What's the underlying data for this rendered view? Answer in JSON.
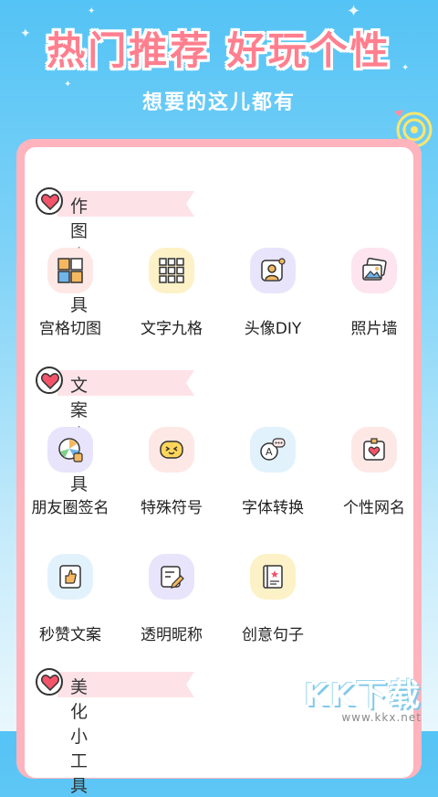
{
  "banner": {
    "title": "热门推荐 好玩个性",
    "subtitle": "想要的这儿都有"
  },
  "sections": [
    {
      "label": "作图小工具",
      "tools": [
        {
          "label": "宫格切图",
          "icon": "grid-split-icon",
          "bg": "#fde8e6"
        },
        {
          "label": "文字九格",
          "icon": "nine-grid-text-icon",
          "bg": "#fdf1c7"
        },
        {
          "label": "头像DIY",
          "icon": "avatar-diy-icon",
          "bg": "#e8e4fb"
        },
        {
          "label": "照片墙",
          "icon": "photo-wall-icon",
          "bg": "#fde4ee"
        }
      ]
    },
    {
      "label": "文案小工具",
      "tools": [
        {
          "label": "朋友圈签名",
          "icon": "moments-signature-icon",
          "bg": "#e8e4fb"
        },
        {
          "label": "特殊符号",
          "icon": "emoji-symbol-icon",
          "bg": "#fde8e6"
        },
        {
          "label": "字体转换",
          "icon": "font-convert-icon",
          "bg": "#e2f2fc"
        },
        {
          "label": "个性网名",
          "icon": "nickname-card-icon",
          "bg": "#fde8e6"
        },
        {
          "label": "秒赞文案",
          "icon": "thumbs-up-icon",
          "bg": "#e2f2fc"
        },
        {
          "label": "透明昵称",
          "icon": "transparent-name-icon",
          "bg": "#e8e4fb"
        },
        {
          "label": "创意句子",
          "icon": "creative-book-icon",
          "bg": "#fdf1c7"
        }
      ]
    },
    {
      "label": "美化小工具",
      "tools": []
    }
  ],
  "watermark": {
    "logo": "KK下载",
    "url": "www.kkx.net"
  },
  "colors": {
    "background_top": "#54c3f5",
    "title": "#ff7f8e",
    "card_frame": "#ffb3bd",
    "ribbon": "#fde3e7"
  }
}
